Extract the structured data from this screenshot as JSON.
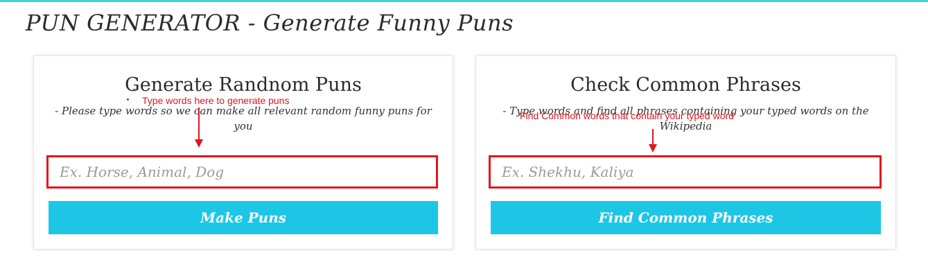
{
  "page": {
    "title": "PUN GENERATOR - Generate Funny Puns",
    "accent_color": "#3fd6d2"
  },
  "left_card": {
    "title": "Generate Randnom Puns",
    "description": "- Please type words so we can make all relevant random funny puns for you",
    "input_placeholder": "Ex. Horse, Animal, Dog",
    "input_value": "",
    "button_label": "Make Puns",
    "annotation": "Type words here to generate puns"
  },
  "right_card": {
    "title": "Check Common Phrases",
    "description": "- Type words and find all phrases containing your typed words on the Wikipedia",
    "input_placeholder": "Ex. Shekhu, Kaliya",
    "input_value": "",
    "button_label": "Find Common Phrases",
    "annotation": "Find Common words that contain your typed word"
  },
  "colors": {
    "button": "#1ec6e6",
    "annotation": "#e3141c"
  }
}
